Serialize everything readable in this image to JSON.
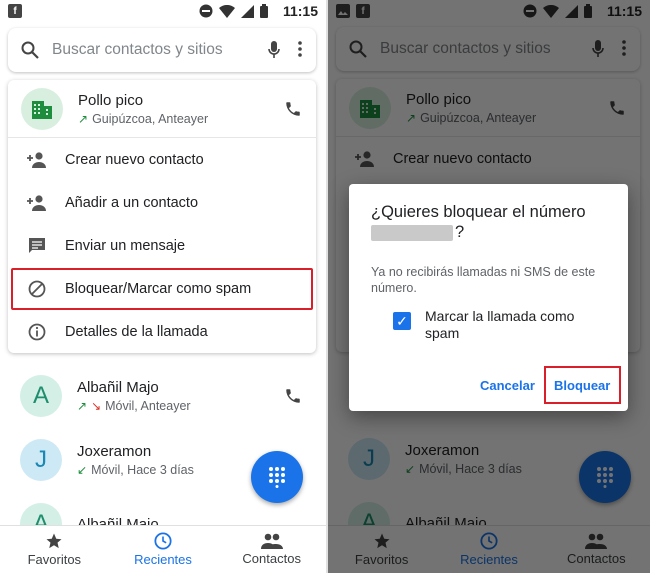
{
  "status": {
    "time": "11:15",
    "icon_letter": "f"
  },
  "search": {
    "placeholder": "Buscar contactos y sitios"
  },
  "selected_call": {
    "name": "Pollo pico",
    "detail": "Guipúzcoa, Anteayer"
  },
  "menu": {
    "items": [
      {
        "label": "Crear nuevo contacto",
        "icon": "add-person-icon"
      },
      {
        "label": "Añadir a un contacto",
        "icon": "add-person-icon"
      },
      {
        "label": "Enviar un mensaje",
        "icon": "message-icon"
      },
      {
        "label": "Bloquear/Marcar como spam",
        "icon": "block-icon",
        "highlighted": true
      },
      {
        "label": "Detalles de la llamada",
        "icon": "info-icon"
      }
    ]
  },
  "calls": [
    {
      "initial": "A",
      "name": "Albañil Majo",
      "detail": "Móvil, Anteayer"
    },
    {
      "initial": "J",
      "name": "Joxeramon",
      "detail": "Móvil, Hace 3 días"
    },
    {
      "initial": "A",
      "name": "Albañil Majo",
      "detail": ""
    }
  ],
  "nav": {
    "favoritos": "Favoritos",
    "recientes": "Recientes",
    "contactos": "Contactos"
  },
  "dialog": {
    "title_prefix": "¿Quieres bloquear el número",
    "title_suffix": "?",
    "body": "Ya no recibirás llamadas ni SMS de este número.",
    "checkbox_label": "Marcar la llamada como spam",
    "checkbox_checked": true,
    "cancel": "Cancelar",
    "confirm": "Bloquear"
  },
  "colors": {
    "accent": "#1a73e8",
    "highlight": "#d9202a"
  }
}
